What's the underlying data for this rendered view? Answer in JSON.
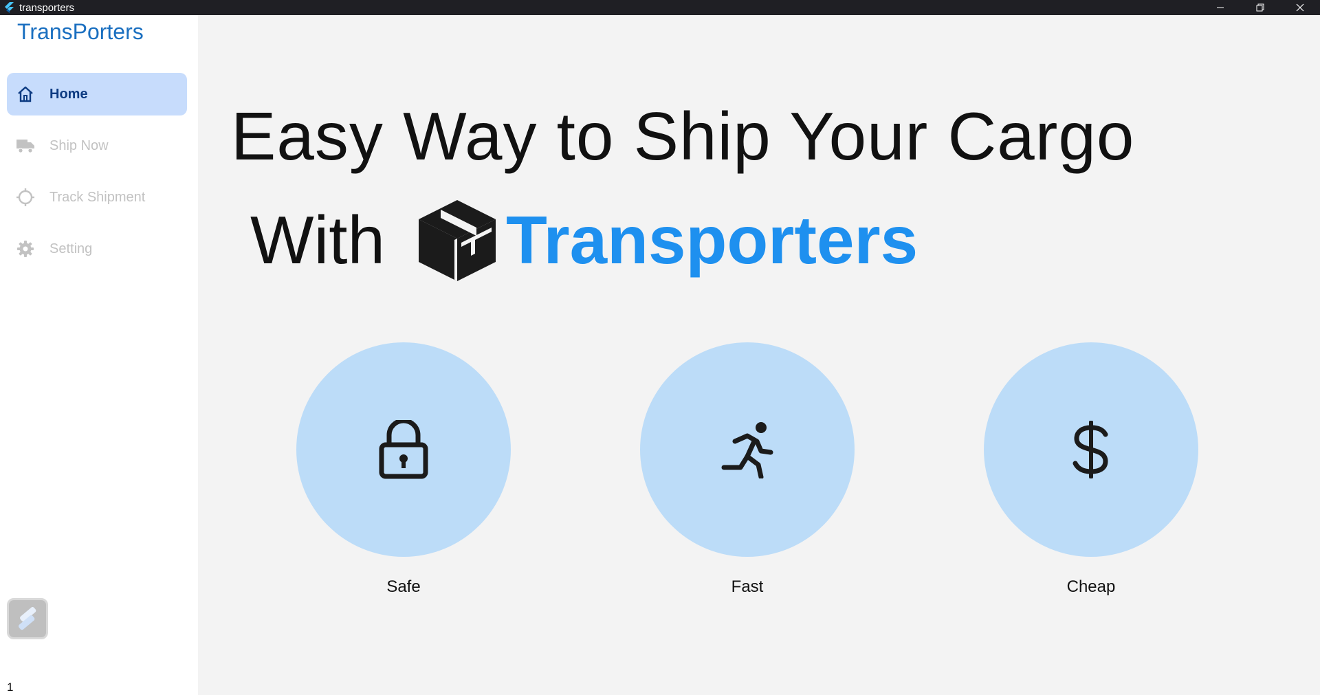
{
  "window": {
    "title": "transporters",
    "controls": [
      "minimize-icon",
      "restore-icon",
      "close-icon"
    ]
  },
  "sidebar": {
    "brand": "TransPorters",
    "items": [
      {
        "label": "Home",
        "icon": "home-icon",
        "active": true
      },
      {
        "label": "Ship Now",
        "icon": "truck-icon",
        "active": false
      },
      {
        "label": "Track Shipment",
        "icon": "crosshair-icon",
        "active": false
      },
      {
        "label": "Setting",
        "icon": "gear-icon",
        "active": false
      }
    ],
    "footer_version": "1"
  },
  "hero": {
    "line1": "Easy Way to Ship Your Cargo",
    "line2_prefix": "With",
    "line2_brand": "Transporters"
  },
  "features": [
    {
      "label": "Safe",
      "icon": "lock-icon"
    },
    {
      "label": "Fast",
      "icon": "running-person-icon"
    },
    {
      "label": "Cheap",
      "icon": "dollar-icon"
    }
  ],
  "colors": {
    "accent": "#1e90ef",
    "brand_text": "#1a6fc0",
    "active_nav_bg": "#c7dcfc",
    "feature_circle": "#bcdcf8"
  }
}
